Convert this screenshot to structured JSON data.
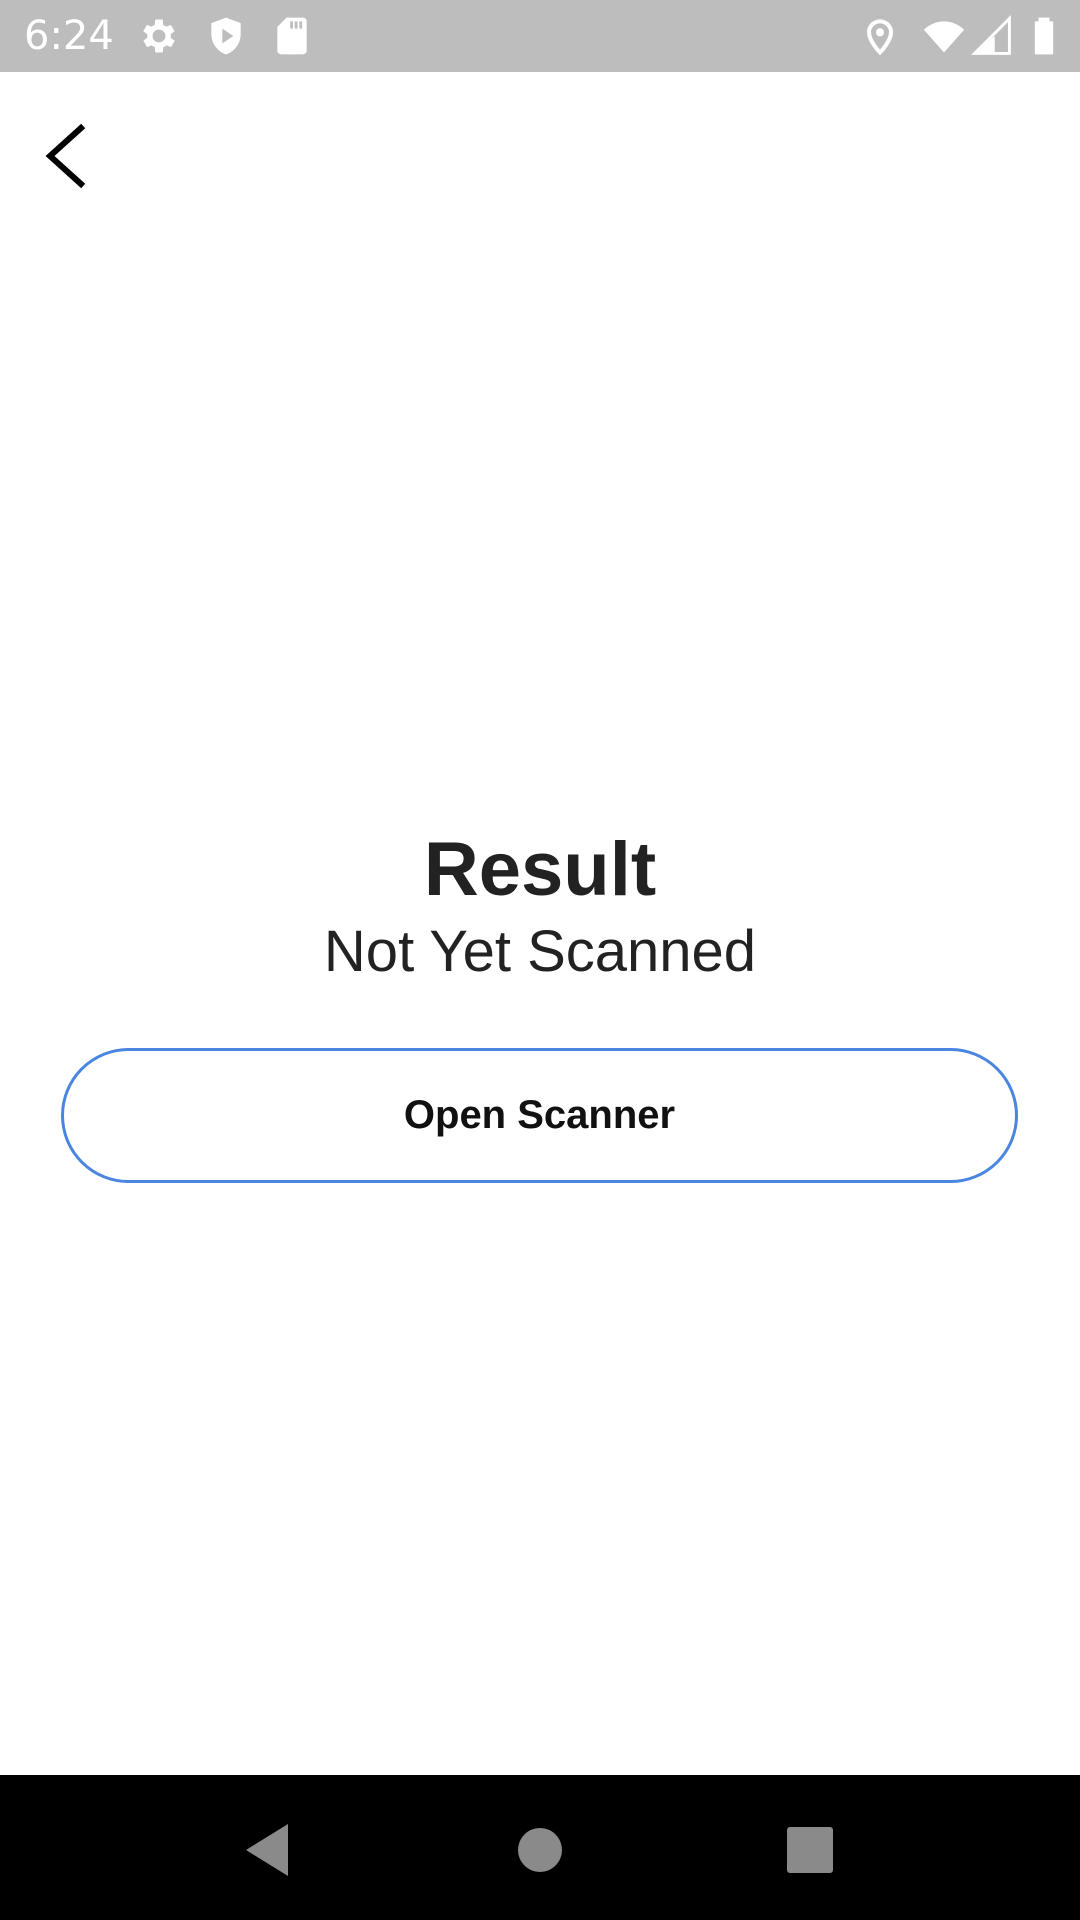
{
  "status_bar": {
    "time": "6:24",
    "icons": [
      "settings-icon",
      "shield-play-icon",
      "sd-card-icon",
      "location-icon",
      "wifi-icon",
      "cell-signal-icon",
      "battery-icon"
    ],
    "background_color": "#bdbdbd"
  },
  "toolbar": {
    "back_icon": "back-arrow-icon"
  },
  "result": {
    "title": "Result",
    "value": "Not Yet Scanned"
  },
  "actions": {
    "open_scanner_label": "Open Scanner",
    "border_color": "#4a86e0"
  },
  "navigation_bar": {
    "buttons": [
      "back-triangle-icon",
      "home-circle-icon",
      "recents-square-icon"
    ]
  }
}
